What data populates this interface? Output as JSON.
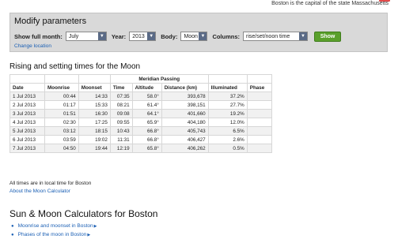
{
  "top": {
    "caption": "Boston is the capital of the state Massachusetts"
  },
  "params": {
    "title": "Modify parameters",
    "month_label": "Show full month:",
    "month_value": "July",
    "year_label": "Year:",
    "year_value": "2013",
    "body_label": "Body:",
    "body_value": "Moon",
    "columns_label": "Columns:",
    "columns_value": "rise/set/noon time",
    "show_label": "Show",
    "change_location": "Change location"
  },
  "moon": {
    "title": "Rising and setting times for the Moon",
    "group_header": "Meridian Passing",
    "headers": [
      "Date",
      "Moonrise",
      "Moonset",
      "Time",
      "Altitude",
      "Distance (km)",
      "Illuminated",
      "Phase"
    ],
    "rows": [
      [
        "1 Jul 2013",
        "00:44",
        "14:33",
        "07:35",
        "58.0°",
        "393,678",
        "37.2%",
        ""
      ],
      [
        "2 Jul 2013",
        "01:17",
        "15:33",
        "08:21",
        "61.4°",
        "398,151",
        "27.7%",
        ""
      ],
      [
        "3 Jul 2013",
        "01:51",
        "16:30",
        "09:08",
        "64.1°",
        "401,660",
        "19.2%",
        ""
      ],
      [
        "4 Jul 2013",
        "02:30",
        "17:25",
        "09:55",
        "65.9°",
        "404,180",
        "12.0%",
        ""
      ],
      [
        "5 Jul 2013",
        "03:12",
        "18:15",
        "10:43",
        "66.8°",
        "405,743",
        "6.5%",
        ""
      ],
      [
        "6 Jul 2013",
        "03:59",
        "19:02",
        "11:31",
        "66.8°",
        "406,427",
        "2.6%",
        ""
      ],
      [
        "7 Jul 2013",
        "04:50",
        "19:44",
        "12:19",
        "65.8°",
        "406,262",
        "0.5%",
        ""
      ]
    ],
    "note": "All times are in local time for Boston",
    "about_link": "About the Moon Calculator"
  },
  "sun": {
    "title": "Sun & Moon Calculators for Boston",
    "links": [
      "Moonrise and moonset in Boston",
      "Phases of the moon in Boston"
    ]
  },
  "colors": {
    "link": "#1a5fb4",
    "show_button": "#5aa02c",
    "panel": "#d9d9d9"
  },
  "icons": {
    "bullet": "bullet-icon",
    "arrow": "triangle-right-icon",
    "dropdown": "chevron-down-icon",
    "flag": "flag-icon"
  }
}
